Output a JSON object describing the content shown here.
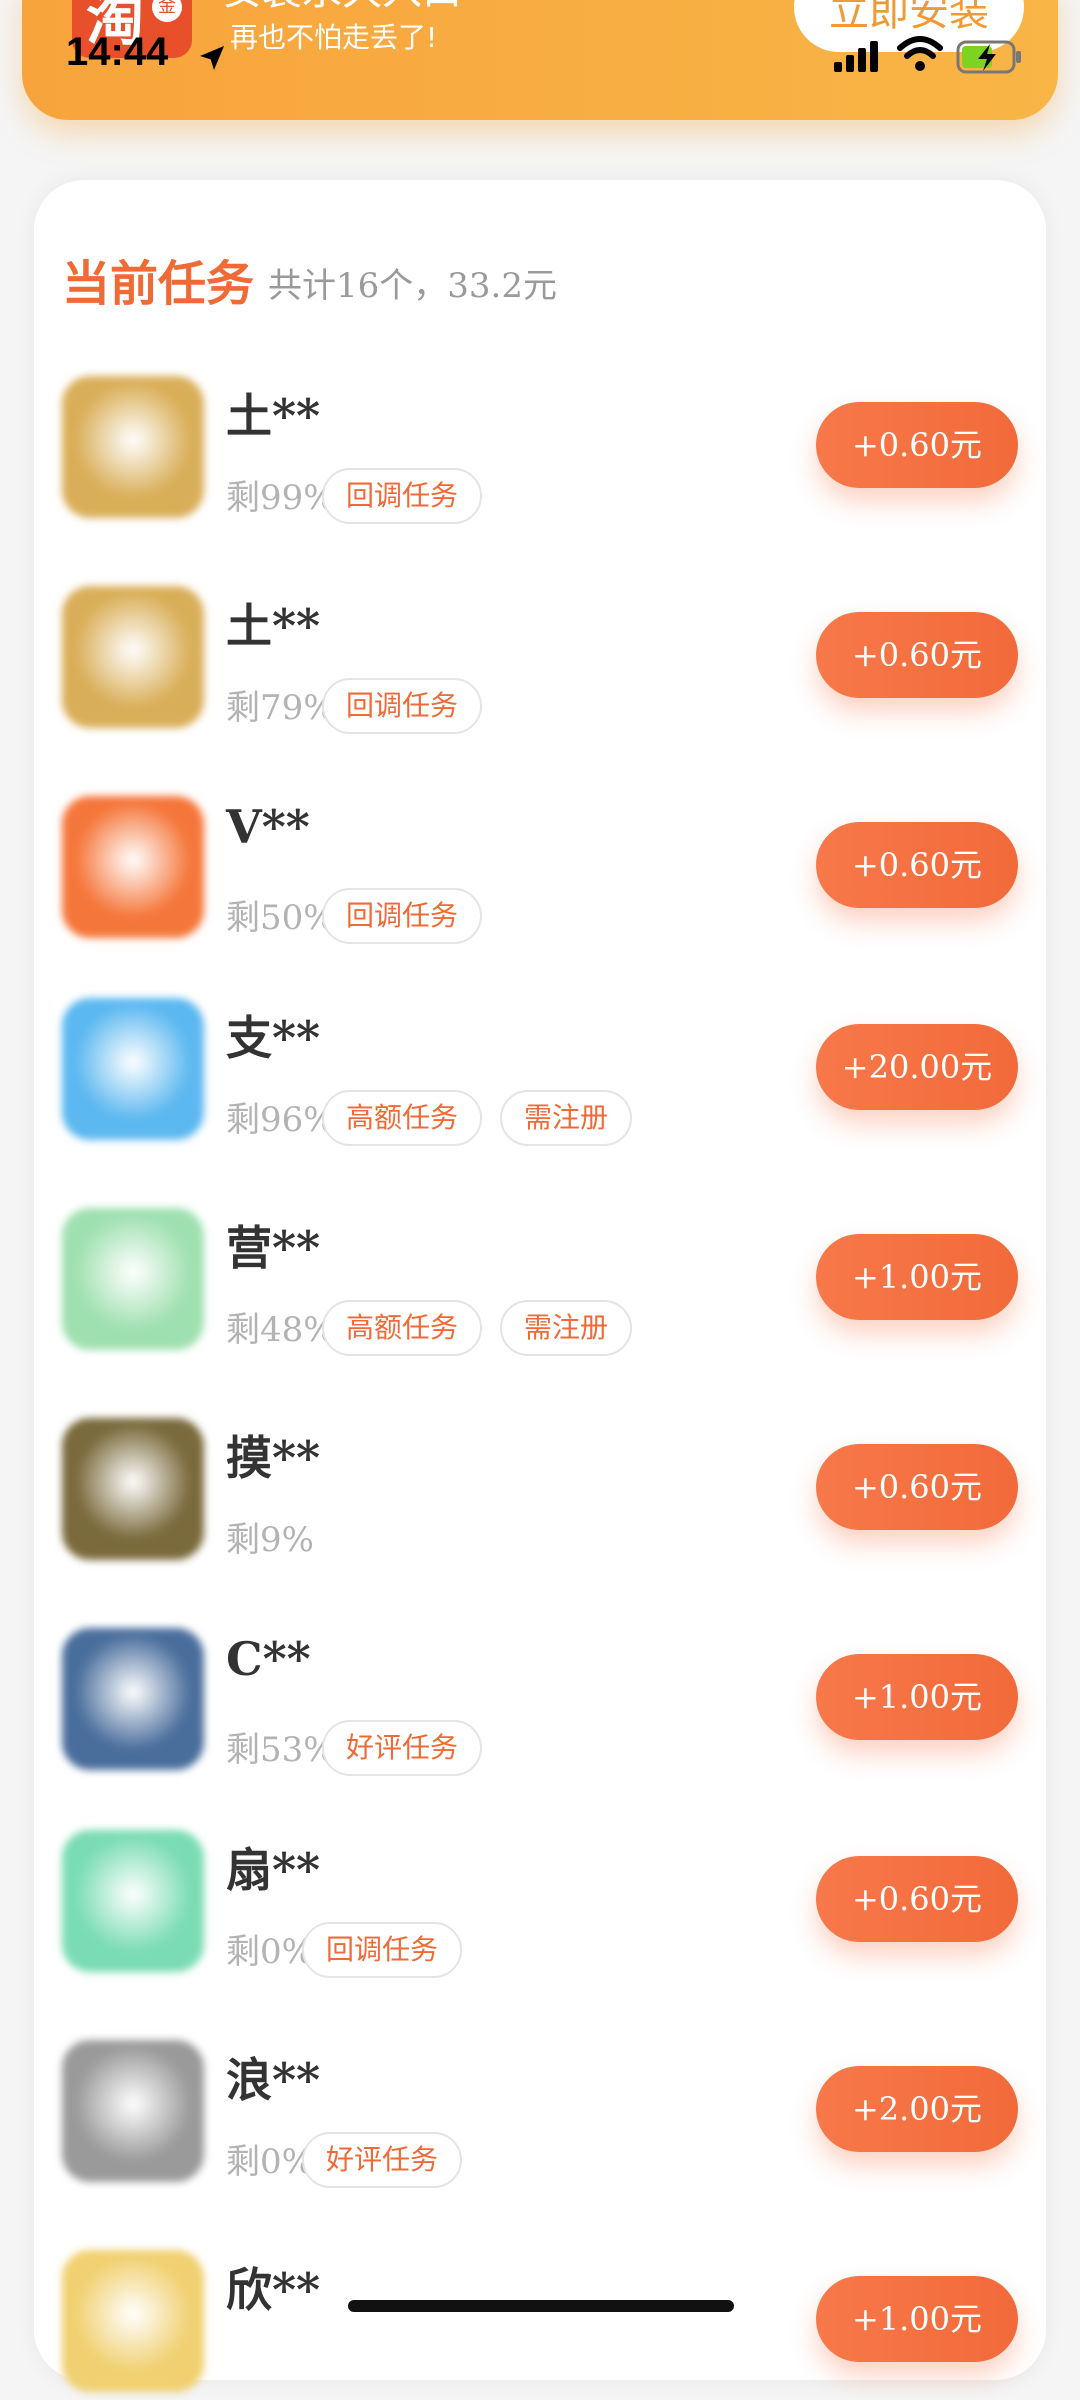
{
  "banner": {
    "logo_glyph": "淘",
    "logo_badge": "金",
    "title": "安装永久入口",
    "subtitle": "再也不怕走丢了!",
    "install_label": "立即安装"
  },
  "status_bar": {
    "time": "14:44"
  },
  "section": {
    "title": "当前任务",
    "summary": "共计16个，33.2元"
  },
  "tasks": [
    {
      "name": "土**",
      "remain": "剩99%",
      "tags": [
        "回调任务"
      ],
      "reward": "+0.60元",
      "icon_color": "#d9ae58"
    },
    {
      "name": "土**",
      "remain": "剩79%",
      "tags": [
        "回调任务"
      ],
      "reward": "+0.60元",
      "icon_color": "#d9ae58"
    },
    {
      "name": "V**",
      "remain": "剩50%",
      "tags": [
        "回调任务"
      ],
      "reward": "+0.60元",
      "icon_color": "#f5763a"
    },
    {
      "name": "支**",
      "remain": "剩96%",
      "tags": [
        "高额任务",
        "需注册"
      ],
      "reward": "+20.00元",
      "icon_color": "#5cb8f0"
    },
    {
      "name": "营**",
      "remain": "剩48%",
      "tags": [
        "高额任务",
        "需注册"
      ],
      "reward": "+1.00元",
      "icon_color": "#9fe0b0"
    },
    {
      "name": "摸**",
      "remain": "剩9%",
      "tags": [],
      "reward": "+0.60元",
      "icon_color": "#7a6a3c"
    },
    {
      "name": "C**",
      "remain": "剩53%",
      "tags": [
        "好评任务"
      ],
      "reward": "+1.00元",
      "icon_color": "#4a6e9c"
    },
    {
      "name": "扇**",
      "remain": "剩0%",
      "tags": [
        "回调任务"
      ],
      "reward": "+0.60元",
      "icon_color": "#7adcb4"
    },
    {
      "name": "浪**",
      "remain": "剩0%",
      "tags": [
        "好评任务"
      ],
      "reward": "+2.00元",
      "icon_color": "#9a9a9a"
    },
    {
      "name": "欣**",
      "remain": "",
      "tags": [],
      "reward": "+1.00元",
      "icon_color": "#f0d070"
    }
  ]
}
